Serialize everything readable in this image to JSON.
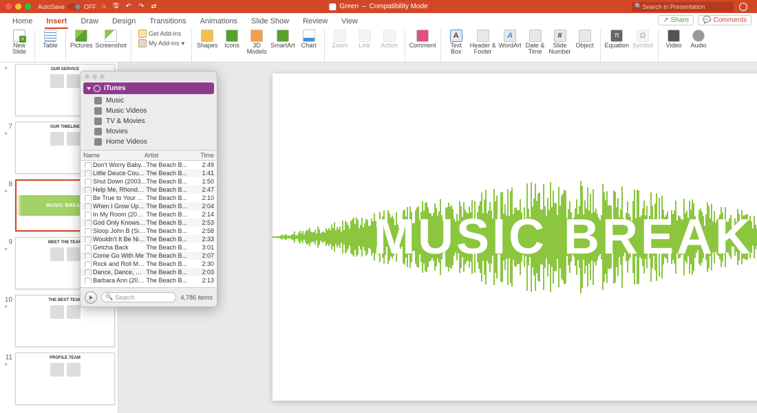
{
  "titlebar": {
    "autosave_label": "AutoSave",
    "autosave_state": "OFF",
    "doc_title": "Green",
    "doc_mode": "Compatibility Mode",
    "search_placeholder": "Search in Presentation"
  },
  "tabs": {
    "items": [
      "Home",
      "Insert",
      "Draw",
      "Design",
      "Transitions",
      "Animations",
      "Slide Show",
      "Review",
      "View"
    ],
    "active_index": 1,
    "share_label": "Share",
    "comments_label": "Comments"
  },
  "ribbon": {
    "new_slide": "New\nSlide",
    "table": "Table",
    "pictures": "Pictures",
    "screenshot": "Screenshot",
    "get_addins": "Get Add-ins",
    "my_addins": "My Add-ins",
    "shapes": "Shapes",
    "icons": "Icons",
    "models": "3D\nModels",
    "smartart": "SmartArt",
    "chart": "Chart",
    "zoom": "Zoom",
    "link": "Link",
    "action": "Action",
    "comment": "Comment",
    "text_box": "Text\nBox",
    "header_footer": "Header &\nFooter",
    "wordart": "WordArt",
    "date_time": "Date &\nTime",
    "slide_number": "Slide\nNumber",
    "object": "Object",
    "equation": "Equation",
    "symbol": "Symbol",
    "video": "Video",
    "audio": "Audio"
  },
  "thumbnails": [
    {
      "num": "",
      "title": "OUR SERVICE"
    },
    {
      "num": "7",
      "title": "OUR TIMELINE"
    },
    {
      "num": "8",
      "title": "MUSIC BREAK",
      "selected": true,
      "music": true
    },
    {
      "num": "9",
      "title": "MEET THE TEAM"
    },
    {
      "num": "10",
      "title": "THE BEST TEAM"
    },
    {
      "num": "11",
      "title": "PROFILE TEAM"
    }
  ],
  "slide": {
    "big_title": "MUSIC BREAK"
  },
  "itunes": {
    "source": "iTunes",
    "categories": [
      "Music",
      "Music Videos",
      "TV & Movies",
      "Movies",
      "Home Videos"
    ],
    "columns": {
      "name": "Name",
      "artist": "Artist",
      "time": "Time"
    },
    "tracks": [
      {
        "name": "Don't Worry Baby...",
        "artist": "The Beach B...",
        "time": "2:49"
      },
      {
        "name": "Little Deuce Coup...",
        "artist": "The Beach B...",
        "time": "1:41"
      },
      {
        "name": "Shut Down (2003...",
        "artist": "The Beach B...",
        "time": "1:50"
      },
      {
        "name": "Help Me, Rhonda (...",
        "artist": "The Beach B...",
        "time": "2:47"
      },
      {
        "name": "Be True to Your Sc...",
        "artist": "The Beach B...",
        "time": "2:10"
      },
      {
        "name": "When I Grow Up (...",
        "artist": "The Beach B...",
        "time": "2:04"
      },
      {
        "name": "In My Room (2001...",
        "artist": "The Beach B...",
        "time": "2:14"
      },
      {
        "name": "God Only Knows (...",
        "artist": "The Beach B...",
        "time": "2:53"
      },
      {
        "name": "Sloop John B (Sin...",
        "artist": "The Beach B...",
        "time": "2:58"
      },
      {
        "name": "Wouldn't It Be Nic...",
        "artist": "The Beach B...",
        "time": "2:33"
      },
      {
        "name": "Getcha Back",
        "artist": "The Beach B...",
        "time": "3:01"
      },
      {
        "name": "Come Go With Me",
        "artist": "The Beach B...",
        "time": "2:07"
      },
      {
        "name": "Rock and Roll Music",
        "artist": "The Beach B...",
        "time": "2:30"
      },
      {
        "name": "Dance, Dance, Da...",
        "artist": "The Beach B...",
        "time": "2:03"
      },
      {
        "name": "Barbara Ann (200...",
        "artist": "The Beach B...",
        "time": "2:13"
      }
    ],
    "search_placeholder": "Search",
    "item_count": "4,786 items"
  },
  "colors": {
    "accent": "#d24726",
    "wave": "#8cc63f"
  }
}
